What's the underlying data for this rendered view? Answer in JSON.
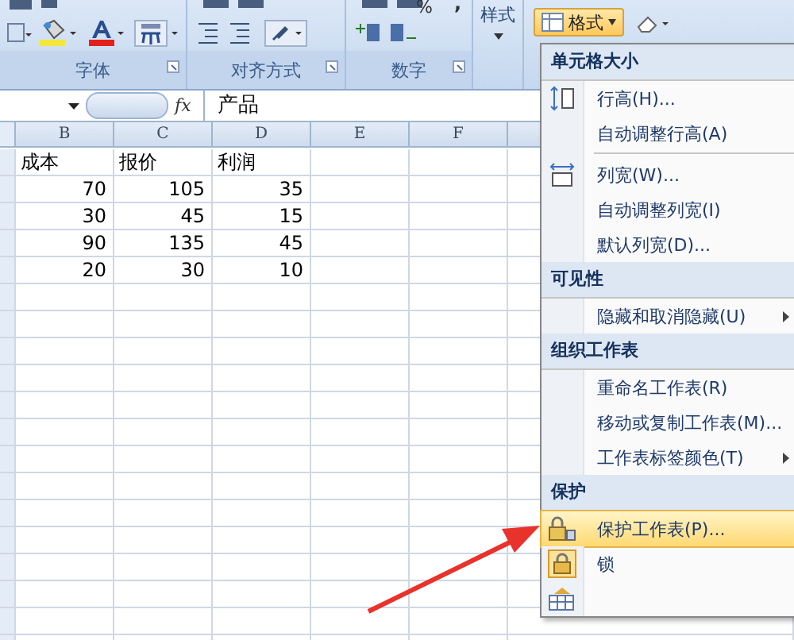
{
  "ribbon": {
    "groups": [
      {
        "label": "字体"
      },
      {
        "label": "对齐方式"
      },
      {
        "label": "数字"
      }
    ],
    "percent": "%",
    "comma": ",",
    "styles_button": "样式",
    "format_button": {
      "label": "格式",
      "selected": true
    }
  },
  "formula_bar": {
    "fx": "fx",
    "content": "产品"
  },
  "sheet": {
    "columns": [
      "B",
      "C",
      "D",
      "E",
      "F"
    ],
    "rows": [
      [
        "成本",
        "报价",
        "利润"
      ],
      [
        "70",
        "105",
        "35"
      ],
      [
        "30",
        "45",
        "15"
      ],
      [
        "90",
        "135",
        "45"
      ],
      [
        "20",
        "30",
        "10"
      ]
    ]
  },
  "menu": {
    "sections": [
      {
        "heading": "单元格大小",
        "items": [
          {
            "kind": "rowheight",
            "label": "行高(H)...",
            "submenu": false,
            "selected": false
          },
          {
            "kind": "plain",
            "label": "自动调整行高(A)",
            "submenu": false,
            "selected": false
          },
          {
            "kind": "separator"
          },
          {
            "kind": "colwidth",
            "label": "列宽(W)...",
            "submenu": false,
            "selected": false
          },
          {
            "kind": "plain",
            "label": "自动调整列宽(I)",
            "submenu": false,
            "selected": false
          },
          {
            "kind": "plain",
            "label": "默认列宽(D)...",
            "submenu": false,
            "selected": false
          }
        ]
      },
      {
        "heading": "可见性",
        "items": [
          {
            "kind": "plain",
            "label": "隐藏和取消隐藏(U)",
            "submenu": true,
            "selected": false
          }
        ]
      },
      {
        "heading": "组织工作表",
        "items": [
          {
            "kind": "plain",
            "label": "重命名工作表(R)",
            "submenu": false,
            "selected": false
          },
          {
            "kind": "plain",
            "label": "移动或复制工作表(M)...",
            "submenu": false,
            "selected": false
          },
          {
            "kind": "plain",
            "label": "工作表标签颜色(T)",
            "submenu": true,
            "selected": false
          }
        ]
      },
      {
        "heading": "保护",
        "items": [
          {
            "kind": "protect",
            "label": "保护工作表(P)...",
            "submenu": false,
            "selected": true
          },
          {
            "kind": "lock",
            "label": "锁",
            "submenu": false,
            "selected": false
          },
          {
            "kind": "cells",
            "submenu": false,
            "selected": false
          }
        ]
      }
    ]
  }
}
